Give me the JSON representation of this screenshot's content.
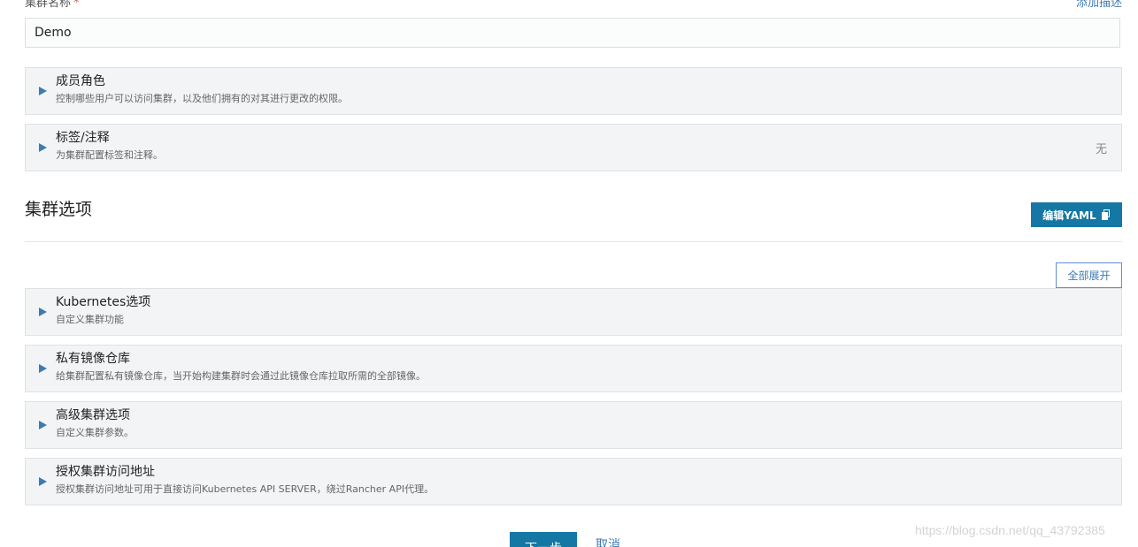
{
  "cluster_name": {
    "label": "集群名称",
    "required_mark": "*",
    "add_description": "添加描述",
    "value": "Demo"
  },
  "top_sections": [
    {
      "title": "成员角色",
      "description": "控制哪些用户可以访问集群，以及他们拥有的对其进行更改的权限。",
      "status": ""
    },
    {
      "title": "标签/注释",
      "description": "为集群配置标签和注释。",
      "status": "无"
    }
  ],
  "cluster_options": {
    "title": "集群选项",
    "edit_yaml_label": "编辑YAML",
    "expand_all_label": "全部展开",
    "sections": [
      {
        "title": "Kubernetes选项",
        "description": "自定义集群功能"
      },
      {
        "title": "私有镜像仓库",
        "description": "给集群配置私有镜像仓库，当开始构建集群时会通过此镜像仓库拉取所需的全部镜像。"
      },
      {
        "title": "高级集群选项",
        "description": "自定义集群参数。"
      },
      {
        "title": "授权集群访问地址",
        "description": "授权集群访问地址可用于直接访问Kubernetes API SERVER，绕过Rancher API代理。"
      }
    ]
  },
  "footer": {
    "next_label": "下一步",
    "cancel_label": "取消"
  },
  "watermark": "https://blog.csdn.net/qq_43792385",
  "colors": {
    "primary": "#1577a4",
    "link": "#3d7ab3",
    "panel_bg": "#f2f4f5",
    "required": "#d9534f"
  }
}
